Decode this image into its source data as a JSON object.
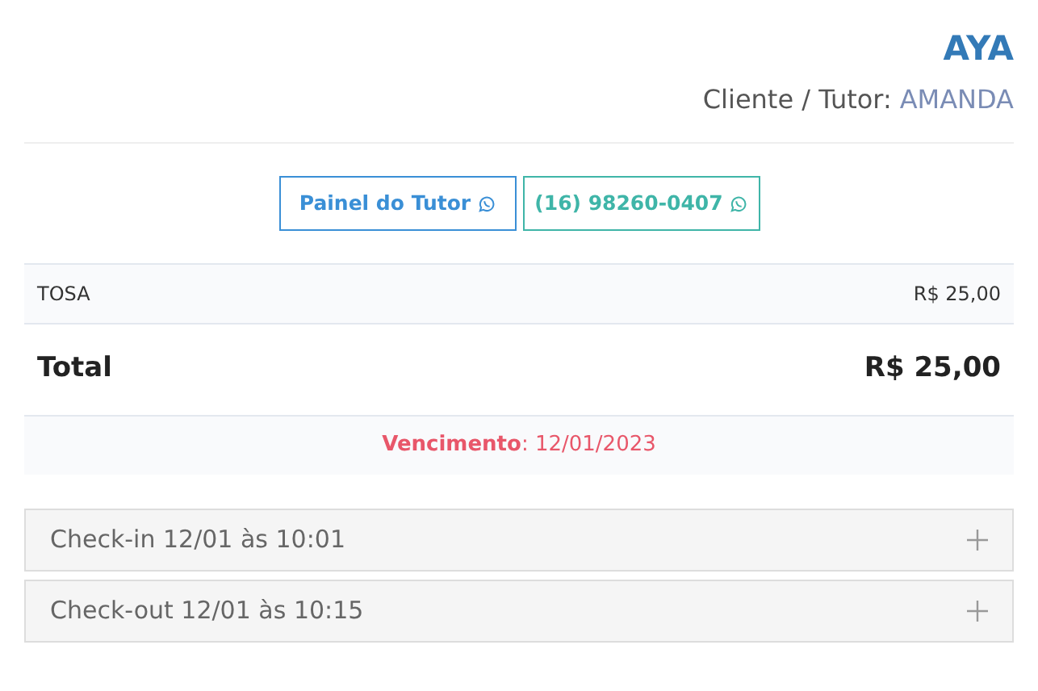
{
  "header": {
    "pet": "AYA",
    "client_label": "Cliente / Tutor:",
    "client_name": "AMANDA"
  },
  "buttons": [
    {
      "label": "Painel do Tutor",
      "kind": "panel"
    },
    {
      "label": "(16) 98260-0407",
      "kind": "phone"
    }
  ],
  "items": [
    {
      "name": "TOSA",
      "price": "R$ 25,00"
    }
  ],
  "total": {
    "label": "Total",
    "value": "R$ 25,00"
  },
  "due": "**Vencimento**: 12/01/2023",
  "panels": [
    {
      "title": "Check-in 12/01 às 10:01",
      "expanded": false
    },
    {
      "title": "Check-out 12/01 às 10:15",
      "expanded": false
    }
  ]
}
